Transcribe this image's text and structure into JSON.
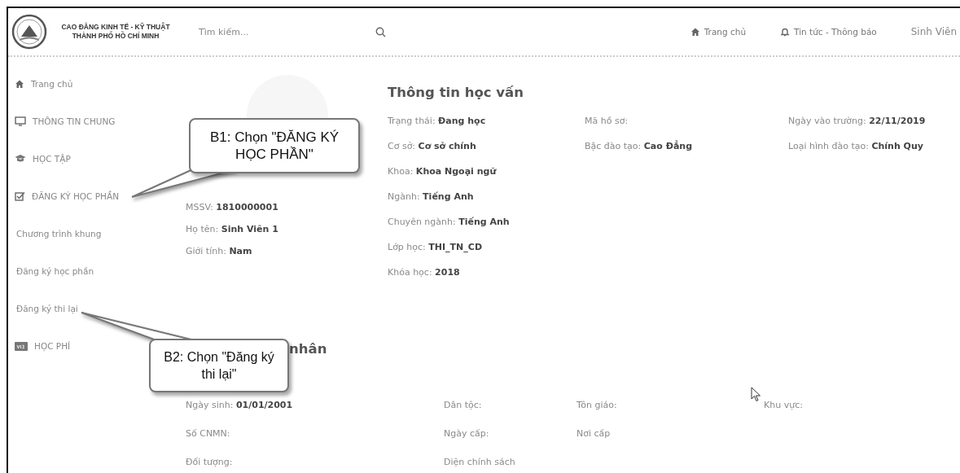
{
  "header": {
    "logo_lines": [
      "CAO ĐẲNG KINH TẾ - KỸ THUẬT",
      "THÀNH PHỐ HỒ CHÍ MINH"
    ],
    "search": {
      "placeholder": "Tìm kiếm..."
    },
    "nav": [
      {
        "kind": "home",
        "label": "Trang chủ"
      },
      {
        "kind": "bell",
        "label": "Tin tức - Thông báo"
      }
    ],
    "user": "Sinh Viên"
  },
  "sidebar": {
    "items": [
      {
        "kind": "home",
        "label": "Trang chủ"
      },
      {
        "kind": "monitor",
        "label": "THÔNG TIN CHUNG"
      },
      {
        "kind": "cap",
        "label": "HỌC TẬP"
      },
      {
        "kind": "check",
        "label": "ĐĂNG KÝ HỌC PHẦN",
        "children": [
          {
            "label": "Chương trình khung"
          },
          {
            "label": "Đăng ký học phần"
          },
          {
            "label": "Đăng ký thi lại"
          }
        ]
      },
      {
        "kind": "card",
        "label": "HỌC PHÍ"
      }
    ]
  },
  "profile": {
    "fields": [
      "MSSV: **1810000001**",
      "Họ tên: **Sinh Viên 1**",
      "Giới tính: **Nam**"
    ]
  },
  "education": {
    "title": "Thông tin học vấn",
    "columns": [
      [
        "Trạng thái: **Đang học**",
        "Cơ sở: **Cơ sở chính**",
        "Khoa: **Khoa Ngoại ngữ**",
        "Ngành: **Tiếng Anh**",
        "Chuyên ngành: **Tiếng Anh**",
        "Lớp học: **THI_TN_CD**",
        "Khóa học: **2018**"
      ],
      [
        "Mã hồ sơ:",
        "Bậc đào tạo: **Cao Đẳng**"
      ],
      [
        "Ngày vào trường: **22/11/2019**",
        "Loại hình đào tạo: **Chính Quy**"
      ]
    ]
  },
  "personal": {
    "title": "nhân",
    "rows": [
      [
        "Ngày sinh: **01/01/2001**",
        "Dân tộc:",
        "Tôn giáo:",
        "Khu vực:"
      ],
      [
        "Số CNMN:",
        "Ngày cấp:",
        "Nơi cấp"
      ],
      [
        "Đối tượng:",
        "Diện chính sách"
      ]
    ]
  },
  "callouts": [
    {
      "text": "B1: Chọn \"ĐĂNG KÝ HỌC PHẦN\""
    },
    {
      "text": "B2: Chọn \"Đăng ký thi lại\""
    }
  ]
}
